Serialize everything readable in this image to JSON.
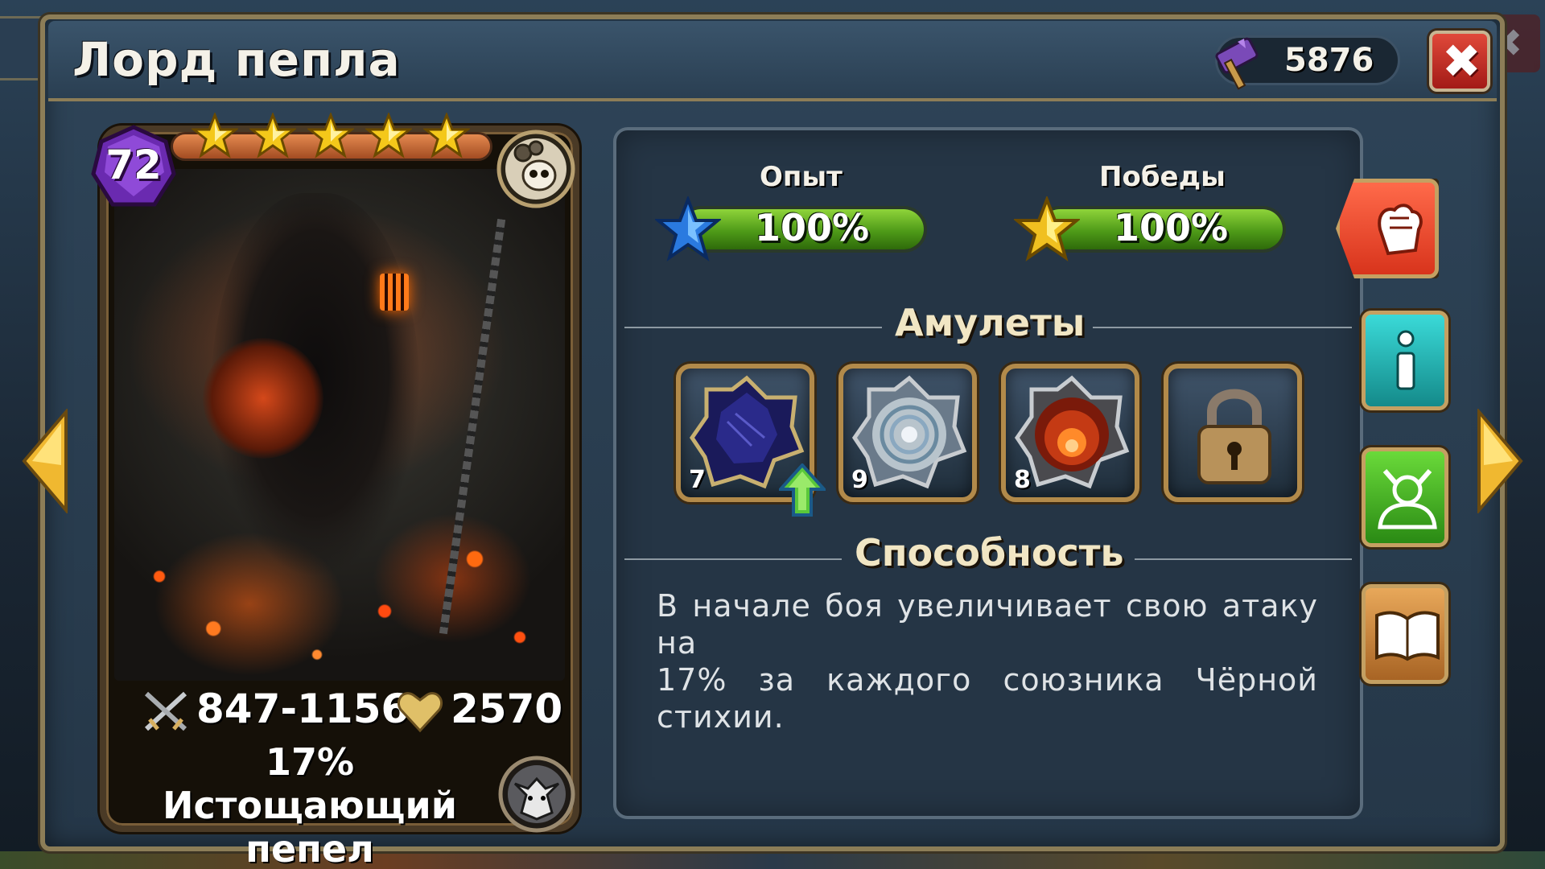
{
  "window": {
    "title": "Лорд пепла",
    "currency_icon": "purple-hammer-icon",
    "currency_value": "5876",
    "close_icon": "close-icon"
  },
  "card": {
    "level": "72",
    "stars": 5,
    "attack": "847-1156",
    "health": "2570",
    "passive": {
      "line1": "17% Истощающий",
      "line2": "пепел"
    },
    "type_icon": "gear-skull-icon",
    "element_icon": "dark-beast-icon",
    "art": "ash-lord-artwork"
  },
  "details": {
    "experience": {
      "label": "Опыт",
      "value_text": "100%",
      "value": 1.0,
      "icon": "blue-star-icon"
    },
    "victories": {
      "label": "Победы",
      "value_text": "100%",
      "value": 1.0,
      "icon": "gold-star-icon"
    },
    "amulets_title": "Амулеты",
    "amulets": [
      {
        "level": "7",
        "icon": "dark-amulet-icon",
        "upgradeable": true
      },
      {
        "level": "9",
        "icon": "silver-amulet-icon",
        "upgradeable": false
      },
      {
        "level": "8",
        "icon": "fire-amulet-icon",
        "upgradeable": false
      },
      {
        "level": "",
        "icon": "padlock-icon",
        "locked": true
      }
    ],
    "ability_title": "Способность",
    "ability_line1": "В начале боя увеличивает свою атаку на",
    "ability_line2": "17% за каждого союзника Чёрной стихии."
  },
  "side_buttons": [
    {
      "name": "battle-button",
      "icon": "fist-icon"
    },
    {
      "name": "info-button",
      "icon": "info-icon"
    },
    {
      "name": "evolve-button",
      "icon": "hero-silhouette-icon"
    },
    {
      "name": "book-button",
      "icon": "book-icon"
    }
  ],
  "navigation": {
    "prev_icon": "arrow-left-icon",
    "next_icon": "arrow-right-icon"
  },
  "colors": {
    "panel": "#253545",
    "gold_border": "#b28a4a",
    "progress_green": "#4e9a18",
    "close_red": "#c4271f"
  }
}
